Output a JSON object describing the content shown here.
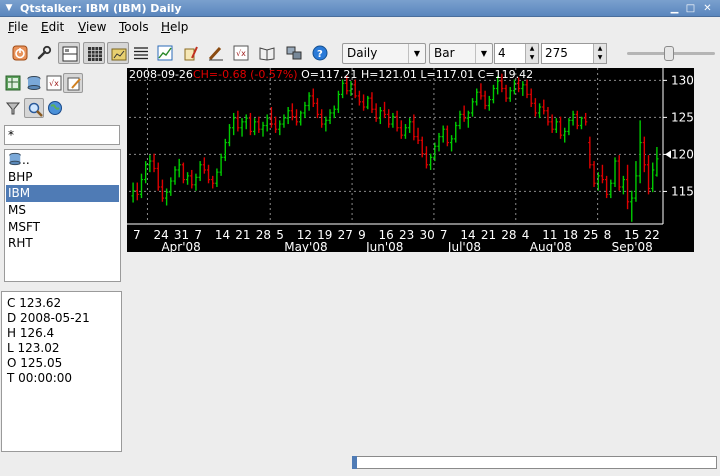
{
  "window": {
    "title": "Qtstalker: IBM (IBM) Daily"
  },
  "menu": {
    "items": [
      {
        "first": "F",
        "rest": "ile"
      },
      {
        "first": "E",
        "rest": "dit"
      },
      {
        "first": "V",
        "rest": "iew"
      },
      {
        "first": "T",
        "rest": "ools"
      },
      {
        "first": "H",
        "rest": "elp"
      }
    ]
  },
  "toolbar": {
    "compression": "Daily",
    "chart_style": "Bar",
    "bar_spacing": "4",
    "bars_to_load": "275"
  },
  "filter": {
    "value": "*"
  },
  "symbols": {
    "parent": "..",
    "items": [
      "BHP",
      "IBM",
      "MS",
      "MSFT",
      "RHT"
    ],
    "selected": "IBM"
  },
  "info": {
    "rows": [
      "C 123.62",
      "D 2008-05-21",
      "H 126.4",
      "L 123.02",
      "O 125.05",
      "T 00:00:00"
    ]
  },
  "chart_data": {
    "type": "ohlc",
    "symbol": "IBM",
    "compression": "Daily",
    "header": {
      "date": "2008-09-26",
      "change": "CH=-0.68 (-0.57%)",
      "open": "O=117.21",
      "high": "H=121.01",
      "low": "L=117.01",
      "close": "C=119.42"
    },
    "y_ticks": [
      "130",
      "125",
      "120",
      "115"
    ],
    "y_tick_values": [
      130,
      125,
      120,
      115
    ],
    "ylim": [
      110.6,
      131.4
    ],
    "x_ticks": [
      "7",
      "24",
      "31",
      "7",
      "14",
      "21",
      "28",
      "5",
      "12",
      "19",
      "27",
      "9",
      "16",
      "23",
      "30",
      "7",
      "14",
      "21",
      "28",
      "4",
      "11",
      "18",
      "25",
      "8",
      "15",
      "22"
    ],
    "month_labels": [
      "Apr'08",
      "May'08",
      "Jun'08",
      "Jul'08",
      "Aug'08",
      "Sep'08"
    ],
    "grid": true,
    "up_color": "#00cc00",
    "down_color": "#dd0000",
    "bars": [
      {
        "open": 114.4,
        "high": 116.2,
        "low": 113.5,
        "close": 115.1
      },
      {
        "open": 115.1,
        "high": 116.2,
        "low": 113.8,
        "close": 114.6
      },
      {
        "open": 114.6,
        "high": 117.4,
        "low": 114.1,
        "close": 116.6
      },
      {
        "open": 116.6,
        "high": 119.1,
        "low": 116.1,
        "close": 118.6
      },
      {
        "open": 118.6,
        "high": 119.9,
        "low": 117.6,
        "close": 119.1
      },
      {
        "open": 119.1,
        "high": 120.1,
        "low": 117.6,
        "close": 118.1
      },
      {
        "open": 118.1,
        "high": 118.9,
        "low": 115.1,
        "close": 115.6
      },
      {
        "open": 115.6,
        "high": 116.6,
        "low": 113.6,
        "close": 114.1
      },
      {
        "open": 114.1,
        "high": 115.4,
        "low": 113.1,
        "close": 114.9
      },
      {
        "open": 114.9,
        "high": 116.9,
        "low": 114.4,
        "close": 116.4
      },
      {
        "open": 116.4,
        "high": 118.4,
        "low": 115.9,
        "close": 117.9
      },
      {
        "open": 117.9,
        "high": 119.4,
        "low": 116.9,
        "close": 118.6
      },
      {
        "open": 118.6,
        "high": 118.9,
        "low": 116.1,
        "close": 116.6
      },
      {
        "open": 116.6,
        "high": 117.6,
        "low": 115.9,
        "close": 117.1
      },
      {
        "open": 117.1,
        "high": 117.9,
        "low": 115.4,
        "close": 115.9
      },
      {
        "open": 115.9,
        "high": 117.4,
        "low": 115.1,
        "close": 116.9
      },
      {
        "open": 116.9,
        "high": 119.1,
        "low": 116.4,
        "close": 118.6
      },
      {
        "open": 118.6,
        "high": 119.6,
        "low": 117.4,
        "close": 117.9
      },
      {
        "open": 117.9,
        "high": 118.6,
        "low": 116.1,
        "close": 116.6
      },
      {
        "open": 116.6,
        "high": 117.1,
        "low": 115.4,
        "close": 116.1
      },
      {
        "open": 116.1,
        "high": 118.1,
        "low": 115.6,
        "close": 117.6
      },
      {
        "open": 117.6,
        "high": 120.1,
        "low": 117.1,
        "close": 119.6
      },
      {
        "open": 119.6,
        "high": 122.1,
        "low": 119.1,
        "close": 121.6
      },
      {
        "open": 121.6,
        "high": 124.1,
        "low": 121.1,
        "close": 123.6
      },
      {
        "open": 123.6,
        "high": 125.6,
        "low": 122.6,
        "close": 124.9
      },
      {
        "open": 124.9,
        "high": 125.9,
        "low": 123.1,
        "close": 123.6
      },
      {
        "open": 123.6,
        "high": 124.9,
        "low": 122.4,
        "close": 124.4
      },
      {
        "open": 124.4,
        "high": 125.4,
        "low": 123.4,
        "close": 124.9
      },
      {
        "open": 124.9,
        "high": 125.6,
        "low": 122.6,
        "close": 123.1
      },
      {
        "open": 123.1,
        "high": 124.9,
        "low": 122.6,
        "close": 124.4
      },
      {
        "open": 124.4,
        "high": 125.1,
        "low": 122.9,
        "close": 123.4
      },
      {
        "open": 123.4,
        "high": 124.4,
        "low": 122.4,
        "close": 123.9
      },
      {
        "open": 123.9,
        "high": 125.4,
        "low": 123.1,
        "close": 124.9
      },
      {
        "open": 124.9,
        "high": 126.4,
        "low": 123.6,
        "close": 124.1
      },
      {
        "open": 124.1,
        "high": 125.1,
        "low": 122.9,
        "close": 123.4
      },
      {
        "open": 123.4,
        "high": 124.6,
        "low": 122.6,
        "close": 124.1
      },
      {
        "open": 124.1,
        "high": 125.4,
        "low": 123.6,
        "close": 124.9
      },
      {
        "open": 124.9,
        "high": 126.4,
        "low": 124.1,
        "close": 125.9
      },
      {
        "open": 125.9,
        "high": 126.9,
        "low": 124.6,
        "close": 125.1
      },
      {
        "open": 125.1,
        "high": 126.1,
        "low": 123.9,
        "close": 124.4
      },
      {
        "open": 124.4,
        "high": 125.9,
        "low": 123.9,
        "close": 125.6
      },
      {
        "open": 125.6,
        "high": 127.1,
        "low": 124.9,
        "close": 126.6
      },
      {
        "open": 126.6,
        "high": 128.4,
        "low": 125.9,
        "close": 127.9
      },
      {
        "open": 127.9,
        "high": 128.9,
        "low": 126.4,
        "close": 126.9
      },
      {
        "open": 126.9,
        "high": 127.6,
        "low": 124.9,
        "close": 125.4
      },
      {
        "open": 125.4,
        "high": 126.1,
        "low": 123.6,
        "close": 124.1
      },
      {
        "open": 124.1,
        "high": 125.1,
        "low": 123.1,
        "close": 124.6
      },
      {
        "open": 124.6,
        "high": 126.1,
        "low": 124.1,
        "close": 125.6
      },
      {
        "open": 125.6,
        "high": 126.6,
        "low": 124.9,
        "close": 126.1
      },
      {
        "open": 126.1,
        "high": 128.6,
        "low": 125.6,
        "close": 128.1
      },
      {
        "open": 128.1,
        "high": 130.1,
        "low": 127.6,
        "close": 129.6
      },
      {
        "open": 129.6,
        "high": 130.6,
        "low": 128.1,
        "close": 128.6
      },
      {
        "open": 128.6,
        "high": 129.9,
        "low": 127.9,
        "close": 129.4
      },
      {
        "open": 129.4,
        "high": 130.1,
        "low": 127.6,
        "close": 127.9
      },
      {
        "open": 127.9,
        "high": 128.6,
        "low": 126.6,
        "close": 127.1
      },
      {
        "open": 127.1,
        "high": 128.1,
        "low": 125.9,
        "close": 126.4
      },
      {
        "open": 126.4,
        "high": 127.9,
        "low": 126.1,
        "close": 127.6
      },
      {
        "open": 127.6,
        "high": 128.4,
        "low": 125.6,
        "close": 126.1
      },
      {
        "open": 126.1,
        "high": 126.9,
        "low": 124.4,
        "close": 124.9
      },
      {
        "open": 124.9,
        "high": 126.4,
        "low": 124.1,
        "close": 125.9
      },
      {
        "open": 125.9,
        "high": 127.1,
        "low": 124.9,
        "close": 125.4
      },
      {
        "open": 125.4,
        "high": 126.1,
        "low": 123.6,
        "close": 124.1
      },
      {
        "open": 124.1,
        "high": 125.6,
        "low": 123.6,
        "close": 125.1
      },
      {
        "open": 125.1,
        "high": 125.9,
        "low": 123.1,
        "close": 123.6
      },
      {
        "open": 123.6,
        "high": 124.6,
        "low": 122.1,
        "close": 122.6
      },
      {
        "open": 122.6,
        "high": 124.1,
        "low": 122.1,
        "close": 123.6
      },
      {
        "open": 123.6,
        "high": 124.9,
        "low": 122.9,
        "close": 124.4
      },
      {
        "open": 124.4,
        "high": 125.4,
        "low": 121.9,
        "close": 122.4
      },
      {
        "open": 122.4,
        "high": 123.6,
        "low": 121.4,
        "close": 121.9
      },
      {
        "open": 121.9,
        "high": 122.4,
        "low": 119.6,
        "close": 120.1
      },
      {
        "open": 120.1,
        "high": 121.1,
        "low": 118.1,
        "close": 118.6
      },
      {
        "open": 118.6,
        "high": 120.1,
        "low": 117.9,
        "close": 119.6
      },
      {
        "open": 119.6,
        "high": 121.6,
        "low": 119.1,
        "close": 121.1
      },
      {
        "open": 121.1,
        "high": 122.9,
        "low": 120.4,
        "close": 122.4
      },
      {
        "open": 122.4,
        "high": 123.9,
        "low": 121.6,
        "close": 123.4
      },
      {
        "open": 123.4,
        "high": 123.9,
        "low": 121.1,
        "close": 121.6
      },
      {
        "open": 121.6,
        "high": 122.6,
        "low": 120.4,
        "close": 122.1
      },
      {
        "open": 122.1,
        "high": 124.4,
        "low": 121.6,
        "close": 123.9
      },
      {
        "open": 123.9,
        "high": 125.9,
        "low": 123.4,
        "close": 125.4
      },
      {
        "open": 125.4,
        "high": 126.6,
        "low": 124.4,
        "close": 124.9
      },
      {
        "open": 124.9,
        "high": 125.9,
        "low": 123.6,
        "close": 125.6
      },
      {
        "open": 125.6,
        "high": 127.6,
        "low": 125.1,
        "close": 127.1
      },
      {
        "open": 127.1,
        "high": 128.9,
        "low": 126.6,
        "close": 128.4
      },
      {
        "open": 128.4,
        "high": 129.6,
        "low": 127.4,
        "close": 127.9
      },
      {
        "open": 127.9,
        "high": 128.6,
        "low": 126.1,
        "close": 126.6
      },
      {
        "open": 126.6,
        "high": 127.9,
        "low": 125.9,
        "close": 127.4
      },
      {
        "open": 127.4,
        "high": 129.4,
        "low": 126.9,
        "close": 128.9
      },
      {
        "open": 128.9,
        "high": 130.6,
        "low": 128.1,
        "close": 129.9
      },
      {
        "open": 129.9,
        "high": 130.9,
        "low": 128.4,
        "close": 128.9
      },
      {
        "open": 128.9,
        "high": 129.4,
        "low": 127.1,
        "close": 127.6
      },
      {
        "open": 127.6,
        "high": 129.1,
        "low": 127.1,
        "close": 128.6
      },
      {
        "open": 128.6,
        "high": 130.1,
        "low": 128.1,
        "close": 129.6
      },
      {
        "open": 129.6,
        "high": 130.4,
        "low": 128.4,
        "close": 128.9
      },
      {
        "open": 128.9,
        "high": 129.9,
        "low": 127.9,
        "close": 129.4
      },
      {
        "open": 129.4,
        "high": 130.1,
        "low": 127.6,
        "close": 128.1
      },
      {
        "open": 128.1,
        "high": 128.9,
        "low": 126.4,
        "close": 126.9
      },
      {
        "open": 126.9,
        "high": 127.6,
        "low": 125.1,
        "close": 125.6
      },
      {
        "open": 125.6,
        "high": 126.9,
        "low": 124.9,
        "close": 126.4
      },
      {
        "open": 126.4,
        "high": 127.4,
        "low": 125.4,
        "close": 125.9
      },
      {
        "open": 125.9,
        "high": 126.4,
        "low": 123.9,
        "close": 124.4
      },
      {
        "open": 124.4,
        "high": 125.4,
        "low": 122.9,
        "close": 123.4
      },
      {
        "open": 123.4,
        "high": 124.9,
        "low": 122.9,
        "close": 124.4
      },
      {
        "open": 124.4,
        "high": 125.1,
        "low": 122.1,
        "close": 122.6
      },
      {
        "open": 122.6,
        "high": 123.6,
        "low": 121.6,
        "close": 123.1
      },
      {
        "open": 123.1,
        "high": 124.9,
        "low": 122.6,
        "close": 124.6
      },
      {
        "open": 124.6,
        "high": 125.9,
        "low": 123.9,
        "close": 125.4
      },
      {
        "open": 125.4,
        "high": 125.9,
        "low": 123.4,
        "close": 123.9
      },
      {
        "open": 123.9,
        "high": 125.1,
        "low": 123.4,
        "close": 124.9
      },
      {
        "open": 124.9,
        "high": 125.6,
        "low": 123.9,
        "close": 124.4
      },
      {
        "open": 121.6,
        "high": 122.4,
        "low": 118.1,
        "close": 118.6
      },
      {
        "open": 118.6,
        "high": 119.1,
        "low": 115.6,
        "close": 116.1
      },
      {
        "open": 116.1,
        "high": 117.6,
        "low": 115.1,
        "close": 117.1
      },
      {
        "open": 117.1,
        "high": 118.6,
        "low": 116.1,
        "close": 116.6
      },
      {
        "open": 116.6,
        "high": 117.1,
        "low": 114.1,
        "close": 114.6
      },
      {
        "open": 114.6,
        "high": 116.6,
        "low": 114.1,
        "close": 116.1
      },
      {
        "open": 116.1,
        "high": 119.6,
        "low": 115.6,
        "close": 119.1
      },
      {
        "open": 119.1,
        "high": 119.9,
        "low": 115.1,
        "close": 115.6
      },
      {
        "open": 115.6,
        "high": 117.1,
        "low": 114.6,
        "close": 116.6
      },
      {
        "open": 116.6,
        "high": 118.6,
        "low": 112.6,
        "close": 113.6
      },
      {
        "open": 113.6,
        "high": 115.1,
        "low": 110.9,
        "close": 114.1
      },
      {
        "open": 114.1,
        "high": 119.1,
        "low": 113.6,
        "close": 117.1
      },
      {
        "open": 117.1,
        "high": 124.6,
        "low": 116.1,
        "close": 121.6
      },
      {
        "open": 121.6,
        "high": 122.4,
        "low": 117.6,
        "close": 118.6
      },
      {
        "open": 118.6,
        "high": 119.9,
        "low": 114.6,
        "close": 115.4
      },
      {
        "open": 115.4,
        "high": 118.9,
        "low": 114.9,
        "close": 117.9
      },
      {
        "open": 117.2,
        "high": 121.0,
        "low": 117.0,
        "close": 119.4
      }
    ]
  },
  "colors": {
    "title_bar": "#5a86bd",
    "selection": "#4f7bb5",
    "chart_bg": "#000000",
    "up_bar": "#00cc00",
    "down_bar": "#dd0000",
    "grid": "#8a8a8a"
  }
}
